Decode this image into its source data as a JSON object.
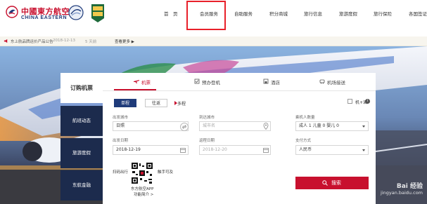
{
  "header": {
    "logo_cn": "中國東方航空",
    "logo_en": "CHINA EASTERN",
    "badge_text": "優質 百強",
    "nav": [
      "首　页",
      "会员服务",
      "自助服务",
      "积分商城",
      "旅行信息",
      "旅游度假",
      "旅行保险",
      "各国签证"
    ]
  },
  "notice": {
    "text": "东上航品牌运价产品公告",
    "date": "2018-12-13",
    "ago": "5 天前",
    "more": "查看更多 ▶"
  },
  "side_tabs": [
    "订购机票",
    "航班动态",
    "旅游度假",
    "东航金融"
  ],
  "booking": {
    "service_tabs": [
      "机票",
      "预办登机",
      "酒店",
      "机场接送"
    ],
    "trip_types": [
      "单程",
      "往返"
    ],
    "multi_label": "多程",
    "plus_label": "机+酒",
    "plus_info": "i",
    "from_label": "出发城市",
    "from_value": "日照",
    "to_label": "到达城市",
    "to_placeholder": "城市名",
    "pax_label": "乘机人数量",
    "pax_value": "成人 1 儿童 0 婴儿 0",
    "depart_label": "出发日期",
    "depart_value": "2018-12-19",
    "return_label": "返程日期",
    "return_placeholder": "2018-12-20",
    "pay_label": "支付方式",
    "pay_value": "人民币",
    "qr_left": "扫码出行",
    "qr_right": "触手可及",
    "qr_caption1": "东方航空APP",
    "qr_caption2": "功能简介 >",
    "search_label": "搜索"
  },
  "watermark": {
    "line1": "Bai 经验",
    "line2": "jingyan.baidu.com"
  },
  "colors": {
    "brand_red": "#c8102e",
    "navy": "#1c2b4d"
  }
}
